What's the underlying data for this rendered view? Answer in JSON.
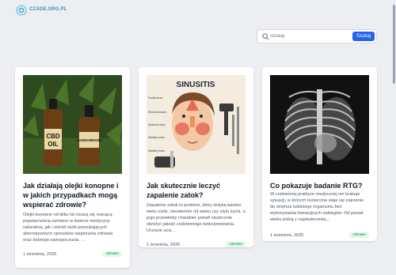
{
  "header": {
    "logo_text": "CZADE.ORG.PL"
  },
  "search": {
    "placeholder": "Szukaj",
    "button_label": "Szukaj"
  },
  "articles": [
    {
      "title": "Jak działają olejki konopne i w jakich przypadkach mogą wspierać zdrowie?",
      "excerpt": "Olejki konopne od kilku lat cieszą się rosnącą popularnością zarówno w świecie medycyny naturalnej, jak i wśród osób poszukujących alternatywnych sposobów wspierania zdrowia oraz dobrego samopoczucia. ...",
      "date": "1 września, 2025",
      "tag": "zdrowie",
      "image_labels": [
        "CBD",
        "OIL",
        "CANNABINOID"
      ]
    },
    {
      "title": "Jak skutecznie leczyć zapalenie zatok?",
      "excerpt": "Zapalenie zatok to problem, który dotyka bardzo wielu osób, niezależnie od wieku czy stylu życia, a jego przewlekły charakter potrafi skutecznie obniżyć jakość codziennego funkcjonowania. Uczucie ucis...",
      "date": "1 września, 2025",
      "tag": "zdrowie",
      "image_labels": [
        "SINUSITIS",
        "Frontal sinus",
        "Ethmoid sinuses",
        "Sphenoid sinus",
        "Maxillary sinus",
        "Maxillary sinus"
      ]
    },
    {
      "title": "Co pokazuje badanie RTG?",
      "excerpt": "W codziennej praktyce medycznej nie brakuje sytuacji, w których konieczne staje się zajrzenie do wnętrza ludzkiego organizmu bez wykonywania inwazyjnych zabiegów. Od ponad wieku jedną z najskuteczniej...",
      "date": "1 września, 2025",
      "tag": "zdrowie"
    }
  ],
  "colors": {
    "accent": "#2563eb",
    "badge_bg": "#dcfce7",
    "badge_text": "#15803d",
    "background": "#eceef2"
  }
}
